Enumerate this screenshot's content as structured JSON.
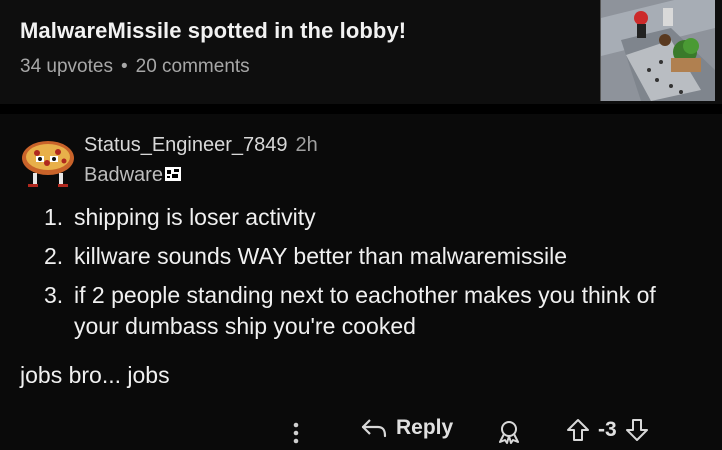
{
  "post": {
    "title": "MalwareMissile spotted in the lobby!",
    "upvotes": "34 upvotes",
    "separator": "•",
    "comments": "20 comments"
  },
  "comment": {
    "username": "Status_Engineer_7849",
    "time": "2h",
    "flair": "Badware",
    "points": [
      {
        "num": "1.",
        "text": "shipping is loser activity"
      },
      {
        "num": "2.",
        "text": "killware sounds WAY better than malwaremissile"
      },
      {
        "num": "3.",
        "text": "if 2 people standing next to eachother makes you think of your dumbass ship you're cooked"
      }
    ],
    "extra": "jobs bro... jobs",
    "score": "-3"
  },
  "actions": {
    "reply_label": "Reply"
  },
  "icons": {
    "more": "more-vertical-icon",
    "reply": "reply-arrow-icon",
    "award": "award-icon",
    "upvote": "upvote-arrow-icon",
    "downvote": "downvote-arrow-icon"
  }
}
